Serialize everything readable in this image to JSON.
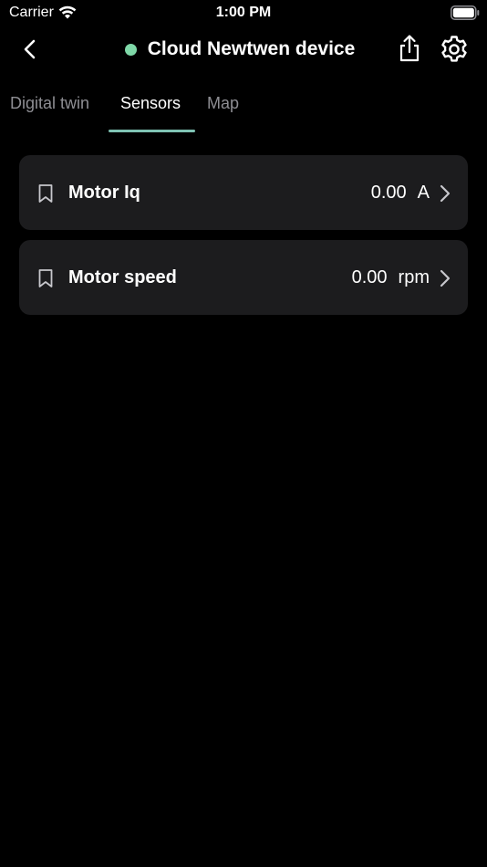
{
  "status_bar": {
    "carrier": "Carrier",
    "time": "1:00 PM",
    "wifi_icon": "wifi-icon",
    "battery_icon": "battery-icon"
  },
  "nav": {
    "back_icon": "chevron-left-icon",
    "title": "Cloud Newtwen device",
    "status_color": "#7fd8a8",
    "share_icon": "share-icon",
    "settings_icon": "gear-icon"
  },
  "tabs": [
    {
      "label": "Digital twin",
      "active": false
    },
    {
      "label": "Sensors",
      "active": true
    },
    {
      "label": "Map",
      "active": false
    }
  ],
  "accent_color": "#7fc3b4",
  "sensors": [
    {
      "name": "Motor Iq",
      "value": "0.00",
      "unit": "A",
      "icon": "bookmark-icon"
    },
    {
      "name": "Motor speed",
      "value": "0.00",
      "unit": "rpm",
      "icon": "bookmark-icon"
    }
  ]
}
